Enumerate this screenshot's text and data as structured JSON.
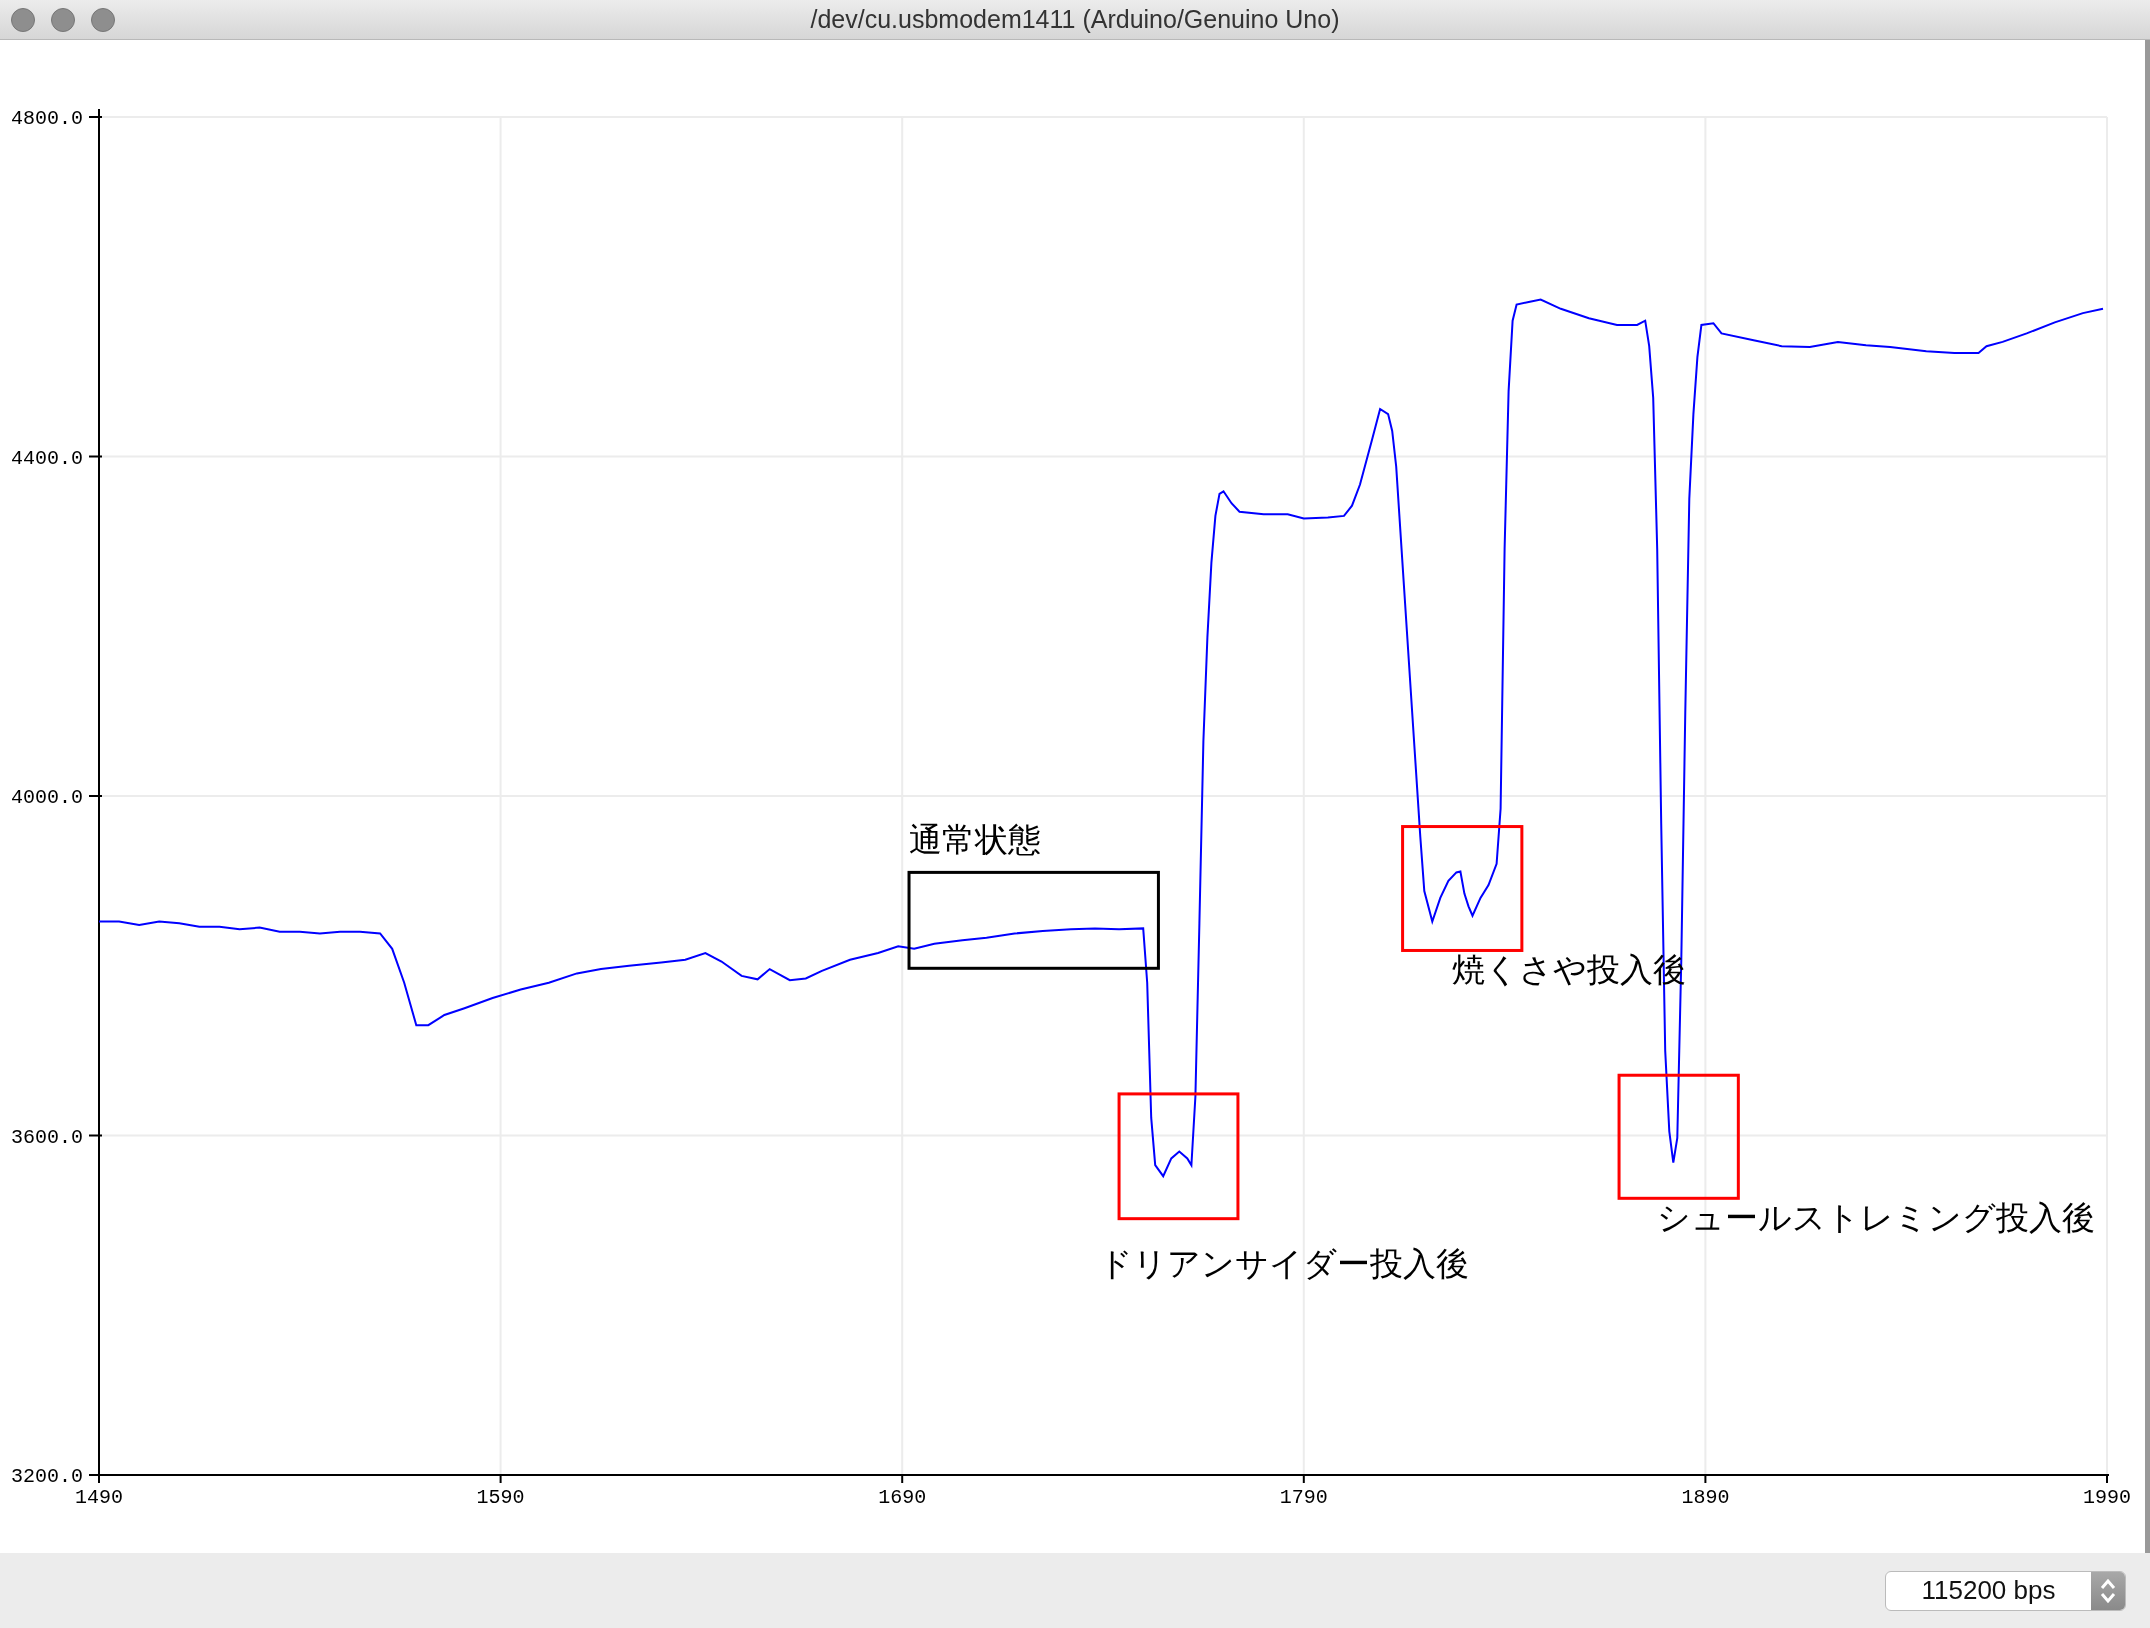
{
  "window": {
    "title": "/dev/cu.usbmodem1411 (Arduino/Genuino Uno)"
  },
  "plot": {
    "chart_data": {
      "type": "line",
      "xlim": [
        1490,
        1990
      ],
      "ylim": [
        3200,
        4800
      ],
      "xticks": [
        {
          "value": 1490,
          "label": "1490"
        },
        {
          "value": 1590,
          "label": "1590"
        },
        {
          "value": 1690,
          "label": "1690"
        },
        {
          "value": 1790,
          "label": "1790"
        },
        {
          "value": 1890,
          "label": "1890"
        },
        {
          "value": 1990,
          "label": "1990"
        }
      ],
      "yticks": [
        {
          "value": 3200,
          "label": "3200.0"
        },
        {
          "value": 3600,
          "label": "3600.0"
        },
        {
          "value": 4000,
          "label": "4000.0"
        },
        {
          "value": 4400,
          "label": "4400.0"
        },
        {
          "value": 4800,
          "label": "4800.0"
        }
      ],
      "x": [
        1490,
        1495,
        1500,
        1505,
        1510,
        1515,
        1520,
        1525,
        1530,
        1535,
        1540,
        1545,
        1550,
        1555,
        1560,
        1563,
        1566,
        1569,
        1572,
        1576,
        1581,
        1588,
        1595,
        1602,
        1609,
        1615,
        1622,
        1630,
        1636,
        1641,
        1645,
        1650,
        1654,
        1657,
        1662,
        1666,
        1670,
        1677,
        1684,
        1689,
        1693,
        1698,
        1705,
        1711,
        1718,
        1725,
        1732,
        1738,
        1744,
        1750,
        1751,
        1752,
        1753,
        1755,
        1757,
        1759,
        1761,
        1762,
        1763,
        1764,
        1765,
        1766,
        1767,
        1768,
        1769,
        1770,
        1772,
        1774,
        1780,
        1786,
        1790,
        1796,
        1800,
        1802,
        1804,
        1807,
        1809,
        1811,
        1812,
        1813,
        1815,
        1817,
        1819,
        1820,
        1822,
        1824,
        1826,
        1828,
        1829,
        1830,
        1831,
        1832,
        1834,
        1836,
        1838,
        1839,
        1840,
        1841,
        1842,
        1843,
        1846,
        1849,
        1854,
        1861,
        1868,
        1873,
        1875,
        1876,
        1877,
        1878,
        1879,
        1880,
        1881,
        1882,
        1883,
        1884,
        1885,
        1886,
        1887,
        1888,
        1889,
        1892,
        1894,
        1902,
        1909,
        1916,
        1923,
        1930,
        1936,
        1945,
        1952,
        1958,
        1960,
        1964,
        1970,
        1977,
        1984,
        1989
      ],
      "grid": true,
      "series": [
        {
          "color": "#0000ff",
          "values": [
            3852,
            3852,
            3848,
            3852,
            3850,
            3846,
            3846,
            3843,
            3845,
            3840,
            3840,
            3838,
            3840,
            3840,
            3838,
            3820,
            3780,
            3730,
            3730,
            3742,
            3750,
            3762,
            3772,
            3780,
            3791,
            3796,
            3800,
            3804,
            3807,
            3815,
            3805,
            3788,
            3784,
            3796,
            3783,
            3785,
            3794,
            3807,
            3815,
            3823,
            3820,
            3826,
            3830,
            3833,
            3838,
            3841,
            3843,
            3844,
            3843,
            3844,
            3780,
            3621,
            3565,
            3552,
            3573,
            3581,
            3573,
            3565,
            3646,
            3850,
            4065,
            4187,
            4275,
            4330,
            4356,
            4359,
            4345,
            4335,
            4332,
            4332,
            4327,
            4328,
            4330,
            4342,
            4367,
            4420,
            4456,
            4450,
            4430,
            4388,
            4243,
            4098,
            3952,
            3888,
            3852,
            3880,
            3900,
            3910,
            3911,
            3885,
            3870,
            3859,
            3880,
            3895,
            3920,
            3985,
            4291,
            4477,
            4560,
            4579,
            4582,
            4585,
            4574,
            4563,
            4555,
            4555,
            4560,
            4530,
            4469,
            4291,
            3968,
            3700,
            3605,
            3568,
            3597,
            3807,
            4100,
            4350,
            4450,
            4517,
            4555,
            4557,
            4545,
            4537,
            4530,
            4529,
            4535,
            4531,
            4529,
            4524,
            4522,
            4522,
            4530,
            4535,
            4545,
            4558,
            4569,
            4574
          ]
        }
      ],
      "annotations": [
        "通常状態",
        "ドリアンサイダー投入後",
        "焼くさや投入後",
        "シュールストレミング投入後"
      ]
    },
    "frames": [
      {
        "color": "#000000"
      },
      {
        "color": "#ff0000"
      },
      {
        "color": "#ff0000"
      },
      {
        "color": "#ff0000"
      }
    ]
  },
  "footer": {
    "baud_select": {
      "value": "115200 bps"
    }
  }
}
